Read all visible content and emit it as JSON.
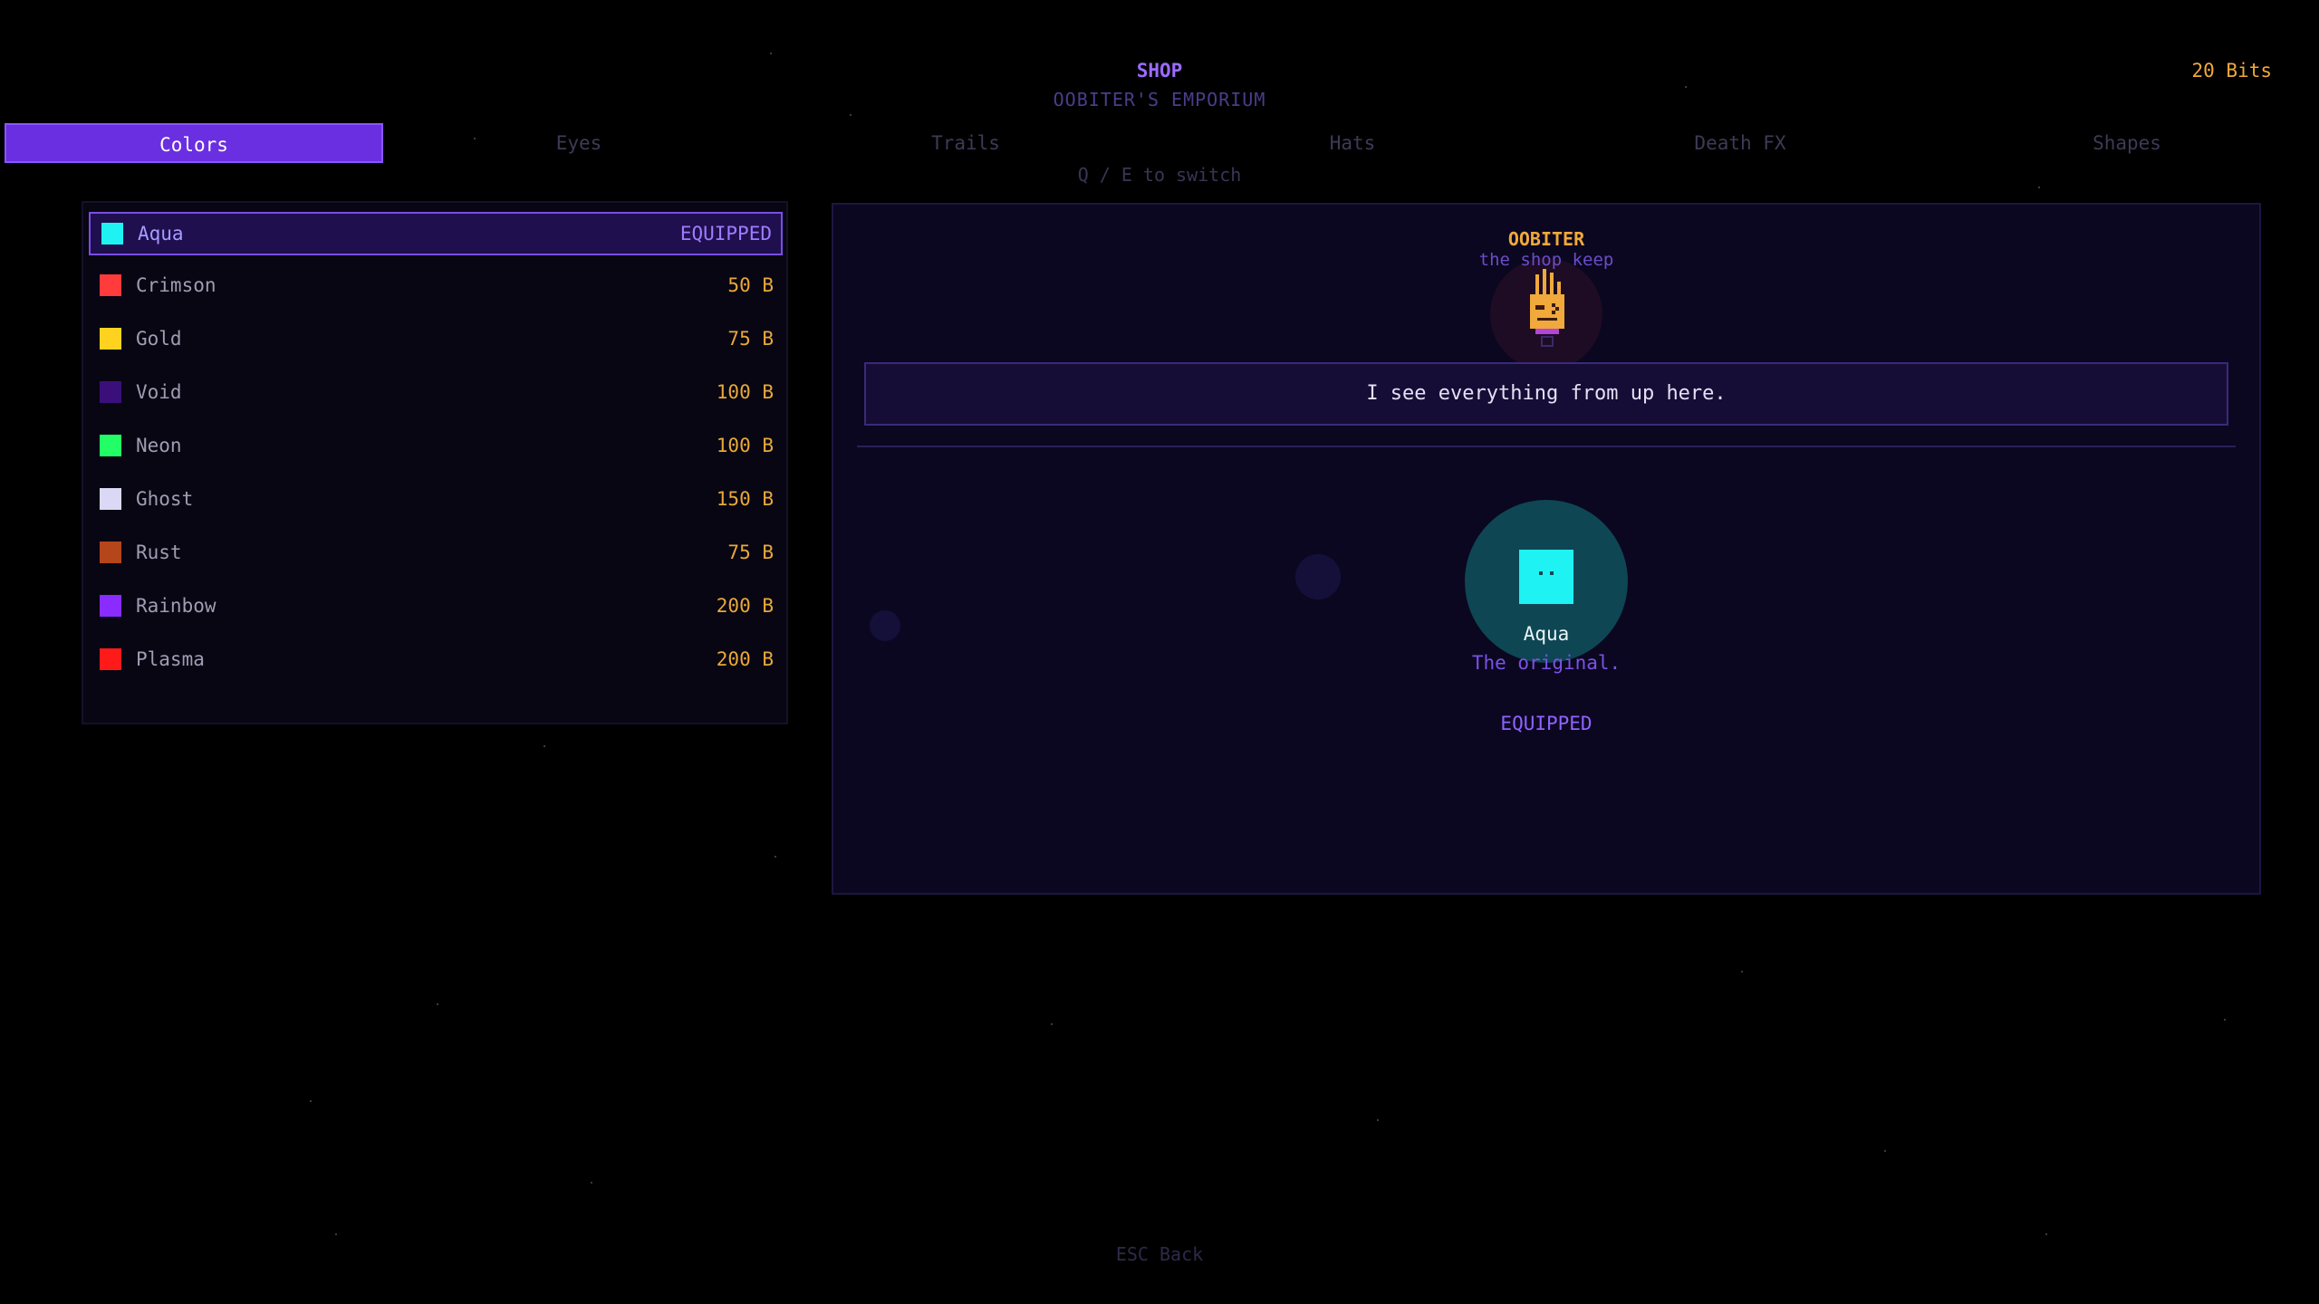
{
  "header": {
    "title": "SHOP",
    "subtitle": "OOBITER'S EMPORIUM",
    "currency": "20 Bits"
  },
  "tabs": [
    {
      "label": "Colors",
      "active": true
    },
    {
      "label": "Eyes",
      "active": false
    },
    {
      "label": "Trails",
      "active": false
    },
    {
      "label": "Hats",
      "active": false
    },
    {
      "label": "Death FX",
      "active": false
    },
    {
      "label": "Shapes",
      "active": false
    }
  ],
  "switch_hint": "Q / E to switch",
  "items": [
    {
      "name": "Aqua",
      "price": "EQUIPPED",
      "color": "#1ff2f2",
      "selected": true
    },
    {
      "name": "Crimson",
      "price": "50 B",
      "color": "#ff3b3b",
      "selected": false
    },
    {
      "name": "Gold",
      "price": "75 B",
      "color": "#ffd21f",
      "selected": false
    },
    {
      "name": "Void",
      "price": "100 B",
      "color": "#3b0f7a",
      "selected": false
    },
    {
      "name": "Neon",
      "price": "100 B",
      "color": "#22ff66",
      "selected": false
    },
    {
      "name": "Ghost",
      "price": "150 B",
      "color": "#dad8f4",
      "selected": false
    },
    {
      "name": "Rust",
      "price": "75 B",
      "color": "#b5451a",
      "selected": false
    },
    {
      "name": "Rainbow",
      "price": "200 B",
      "color": "#8a2cff",
      "selected": false
    },
    {
      "name": "Plasma",
      "price": "200 B",
      "color": "#ff1a1a",
      "selected": false
    }
  ],
  "keeper": {
    "name": "OOBITER",
    "role": "the shop keep",
    "dialogue": "I see everything from up here."
  },
  "preview": {
    "name": "Aqua",
    "description": "The original.",
    "status": "EQUIPPED",
    "color": "#1ff2f2"
  },
  "footer": {
    "hint": "ESC  Back"
  }
}
